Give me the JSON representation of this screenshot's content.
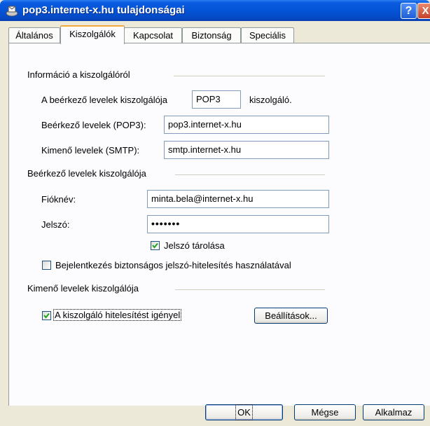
{
  "window": {
    "title": "pop3.internet-x.hu tulajdonságai",
    "help_label": "?",
    "close_label": "X"
  },
  "tabs": [
    {
      "label": "Általános"
    },
    {
      "label": "Kiszolgálók"
    },
    {
      "label": "Kapcsolat"
    },
    {
      "label": "Biztonság"
    },
    {
      "label": "Speciális"
    }
  ],
  "server_info": {
    "heading": "Információ a kiszolgálóról",
    "incoming_type_prefix": "A beérkező levelek kiszolgálója",
    "incoming_type_value": "POP3",
    "incoming_type_suffix": "kiszolgáló.",
    "incoming_label": "Beérkező levelek (POP3):",
    "incoming_value": "pop3.internet-x.hu",
    "outgoing_label": "Kimenő levelek (SMTP):",
    "outgoing_value": "smtp.internet-x.hu"
  },
  "incoming_server": {
    "heading": "Beérkező levelek kiszolgálója",
    "account_label": "Fióknév:",
    "account_value": "minta.bela@internet-x.hu",
    "password_label": "Jelszó:",
    "password_value": "•••••••",
    "remember_password_label": "Jelszó tárolása",
    "remember_password_checked": true,
    "spa_label": "Bejelentkezés biztonságos jelszó-hitelesítés használatával",
    "spa_checked": false
  },
  "outgoing_server": {
    "heading": "Kimenő levelek kiszolgálója",
    "auth_required_label": "A kiszolgáló hitelesítést igényel",
    "auth_required_checked": true,
    "settings_button": "Beállítások..."
  },
  "footer": {
    "ok": "OK",
    "cancel": "Mégse",
    "apply": "Alkalmaz"
  }
}
